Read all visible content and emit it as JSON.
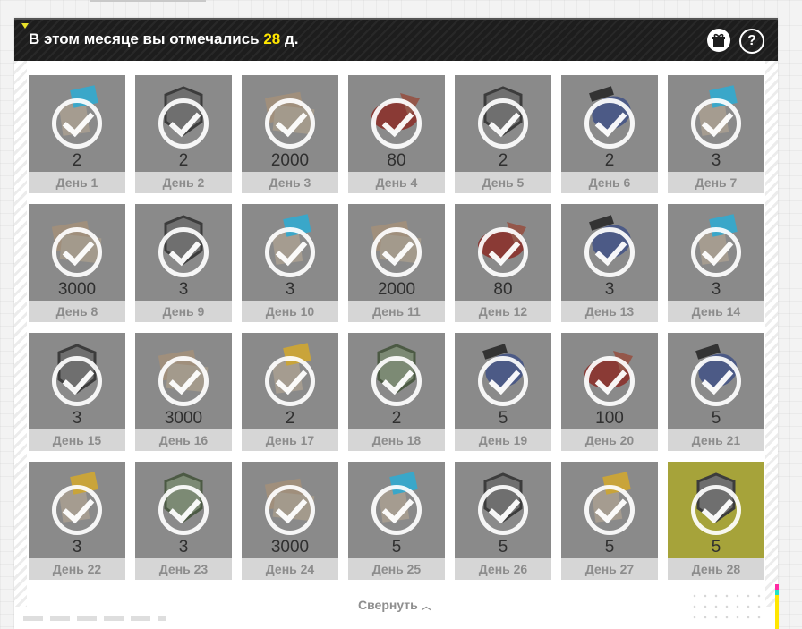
{
  "header": {
    "title_prefix": "В этом месяце вы отмечались ",
    "count": "28",
    "title_suffix": " д.",
    "gift_icon": "gift-icon",
    "help_label": "?"
  },
  "days": [
    {
      "day": "День 1",
      "qty": "2",
      "reward": "exp-card"
    },
    {
      "day": "День 2",
      "qty": "2",
      "reward": "silver-module"
    },
    {
      "day": "День 3",
      "qty": "2000",
      "reward": "coupon-stack"
    },
    {
      "day": "День 4",
      "qty": "80",
      "reward": "red-fuel"
    },
    {
      "day": "День 5",
      "qty": "2",
      "reward": "silver-module"
    },
    {
      "day": "День 6",
      "qty": "2",
      "reward": "blue-chip"
    },
    {
      "day": "День 7",
      "qty": "3",
      "reward": "exp-card"
    },
    {
      "day": "День 8",
      "qty": "3000",
      "reward": "coupon-stack"
    },
    {
      "day": "День 9",
      "qty": "3",
      "reward": "silver-module"
    },
    {
      "day": "День 10",
      "qty": "3",
      "reward": "exp-card"
    },
    {
      "day": "День 11",
      "qty": "2000",
      "reward": "coupon-stack"
    },
    {
      "day": "День 12",
      "qty": "80",
      "reward": "red-fuel"
    },
    {
      "day": "День 13",
      "qty": "3",
      "reward": "blue-chip"
    },
    {
      "day": "День 14",
      "qty": "3",
      "reward": "exp-card"
    },
    {
      "day": "День 15",
      "qty": "3",
      "reward": "silver-module"
    },
    {
      "day": "День 16",
      "qty": "3000",
      "reward": "coupon-stack"
    },
    {
      "day": "День 17",
      "qty": "2",
      "reward": "gold-exp-card"
    },
    {
      "day": "День 18",
      "qty": "2",
      "reward": "green-module"
    },
    {
      "day": "День 19",
      "qty": "5",
      "reward": "blue-chip"
    },
    {
      "day": "День 20",
      "qty": "100",
      "reward": "red-fuel"
    },
    {
      "day": "День 21",
      "qty": "5",
      "reward": "blue-chip"
    },
    {
      "day": "День 22",
      "qty": "3",
      "reward": "gold-exp-card"
    },
    {
      "day": "День 23",
      "qty": "3",
      "reward": "green-module"
    },
    {
      "day": "День 24",
      "qty": "3000",
      "reward": "coupon-stack"
    },
    {
      "day": "День 25",
      "qty": "5",
      "reward": "exp-card"
    },
    {
      "day": "День 26",
      "qty": "5",
      "reward": "silver-module"
    },
    {
      "day": "День 27",
      "qty": "5",
      "reward": "gold-exp-card"
    },
    {
      "day": "День 28",
      "qty": "5",
      "reward": "silver-module",
      "today": true
    }
  ],
  "footer": {
    "collapse_label": "Свернуть",
    "collapse_icon": "chevron-up-icon"
  },
  "colors": {
    "header_bg": "#1d1d1d",
    "accent_yellow": "#ffe600",
    "tile_claimed": "#8a8a8a",
    "tile_today": "#a6a33a",
    "day_label_bg": "#d6d6d6"
  }
}
